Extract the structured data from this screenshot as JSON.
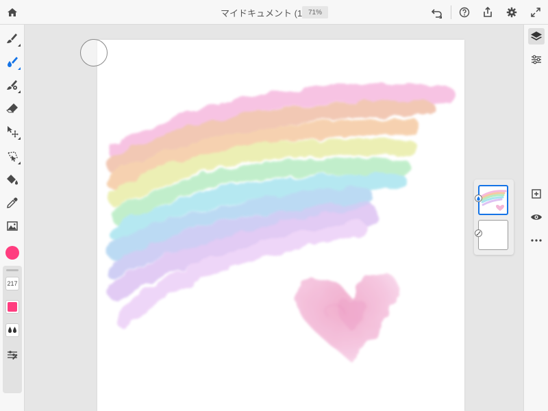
{
  "header": {
    "document_title": "マイドキュメント (1)",
    "zoom_level": "71%",
    "icons": [
      "home-icon",
      "undo-icon",
      "help-icon",
      "share-icon",
      "gear-icon",
      "fullscreen-icon"
    ]
  },
  "left_toolbar": {
    "tools": [
      "pixel-brush-icon",
      "watercolor-brush-icon",
      "vector-brush-icon",
      "eraser-icon",
      "move-icon",
      "lasso-select-icon",
      "fill-icon",
      "eyedropper-icon",
      "image-import-icon"
    ],
    "active_tool": "watercolor-brush-icon",
    "brush_size": "217",
    "current_color": "#ff3d7f"
  },
  "right_toolbar": {
    "icons": [
      "layers-icon",
      "layer-properties-icon",
      "add-layer-icon",
      "visibility-eye-icon",
      "more-options-icon"
    ]
  },
  "layers_panel": {
    "layers": [
      "watercolor-layer",
      "pixel-layer"
    ],
    "selected_index": 0
  },
  "colors": {
    "accent": "#1473e6",
    "toolbar_bg": "#f7f7f7",
    "workspace_bg": "#e6e6e6"
  }
}
